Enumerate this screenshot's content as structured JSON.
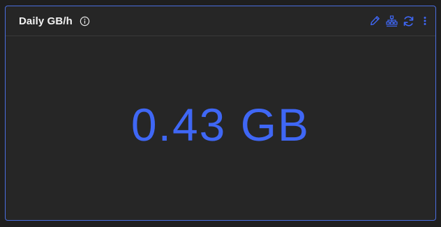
{
  "panel": {
    "title": "Daily GB/h",
    "value": "0.43 GB",
    "accent_color": "#3f67f5",
    "border_color": "#4a6ee0"
  },
  "header": {
    "icons": {
      "info": "info-circle-icon",
      "edit": "pencil-icon",
      "hierarchy": "hierarchy-icon",
      "refresh": "refresh-icon",
      "more": "more-vertical-icon"
    }
  }
}
